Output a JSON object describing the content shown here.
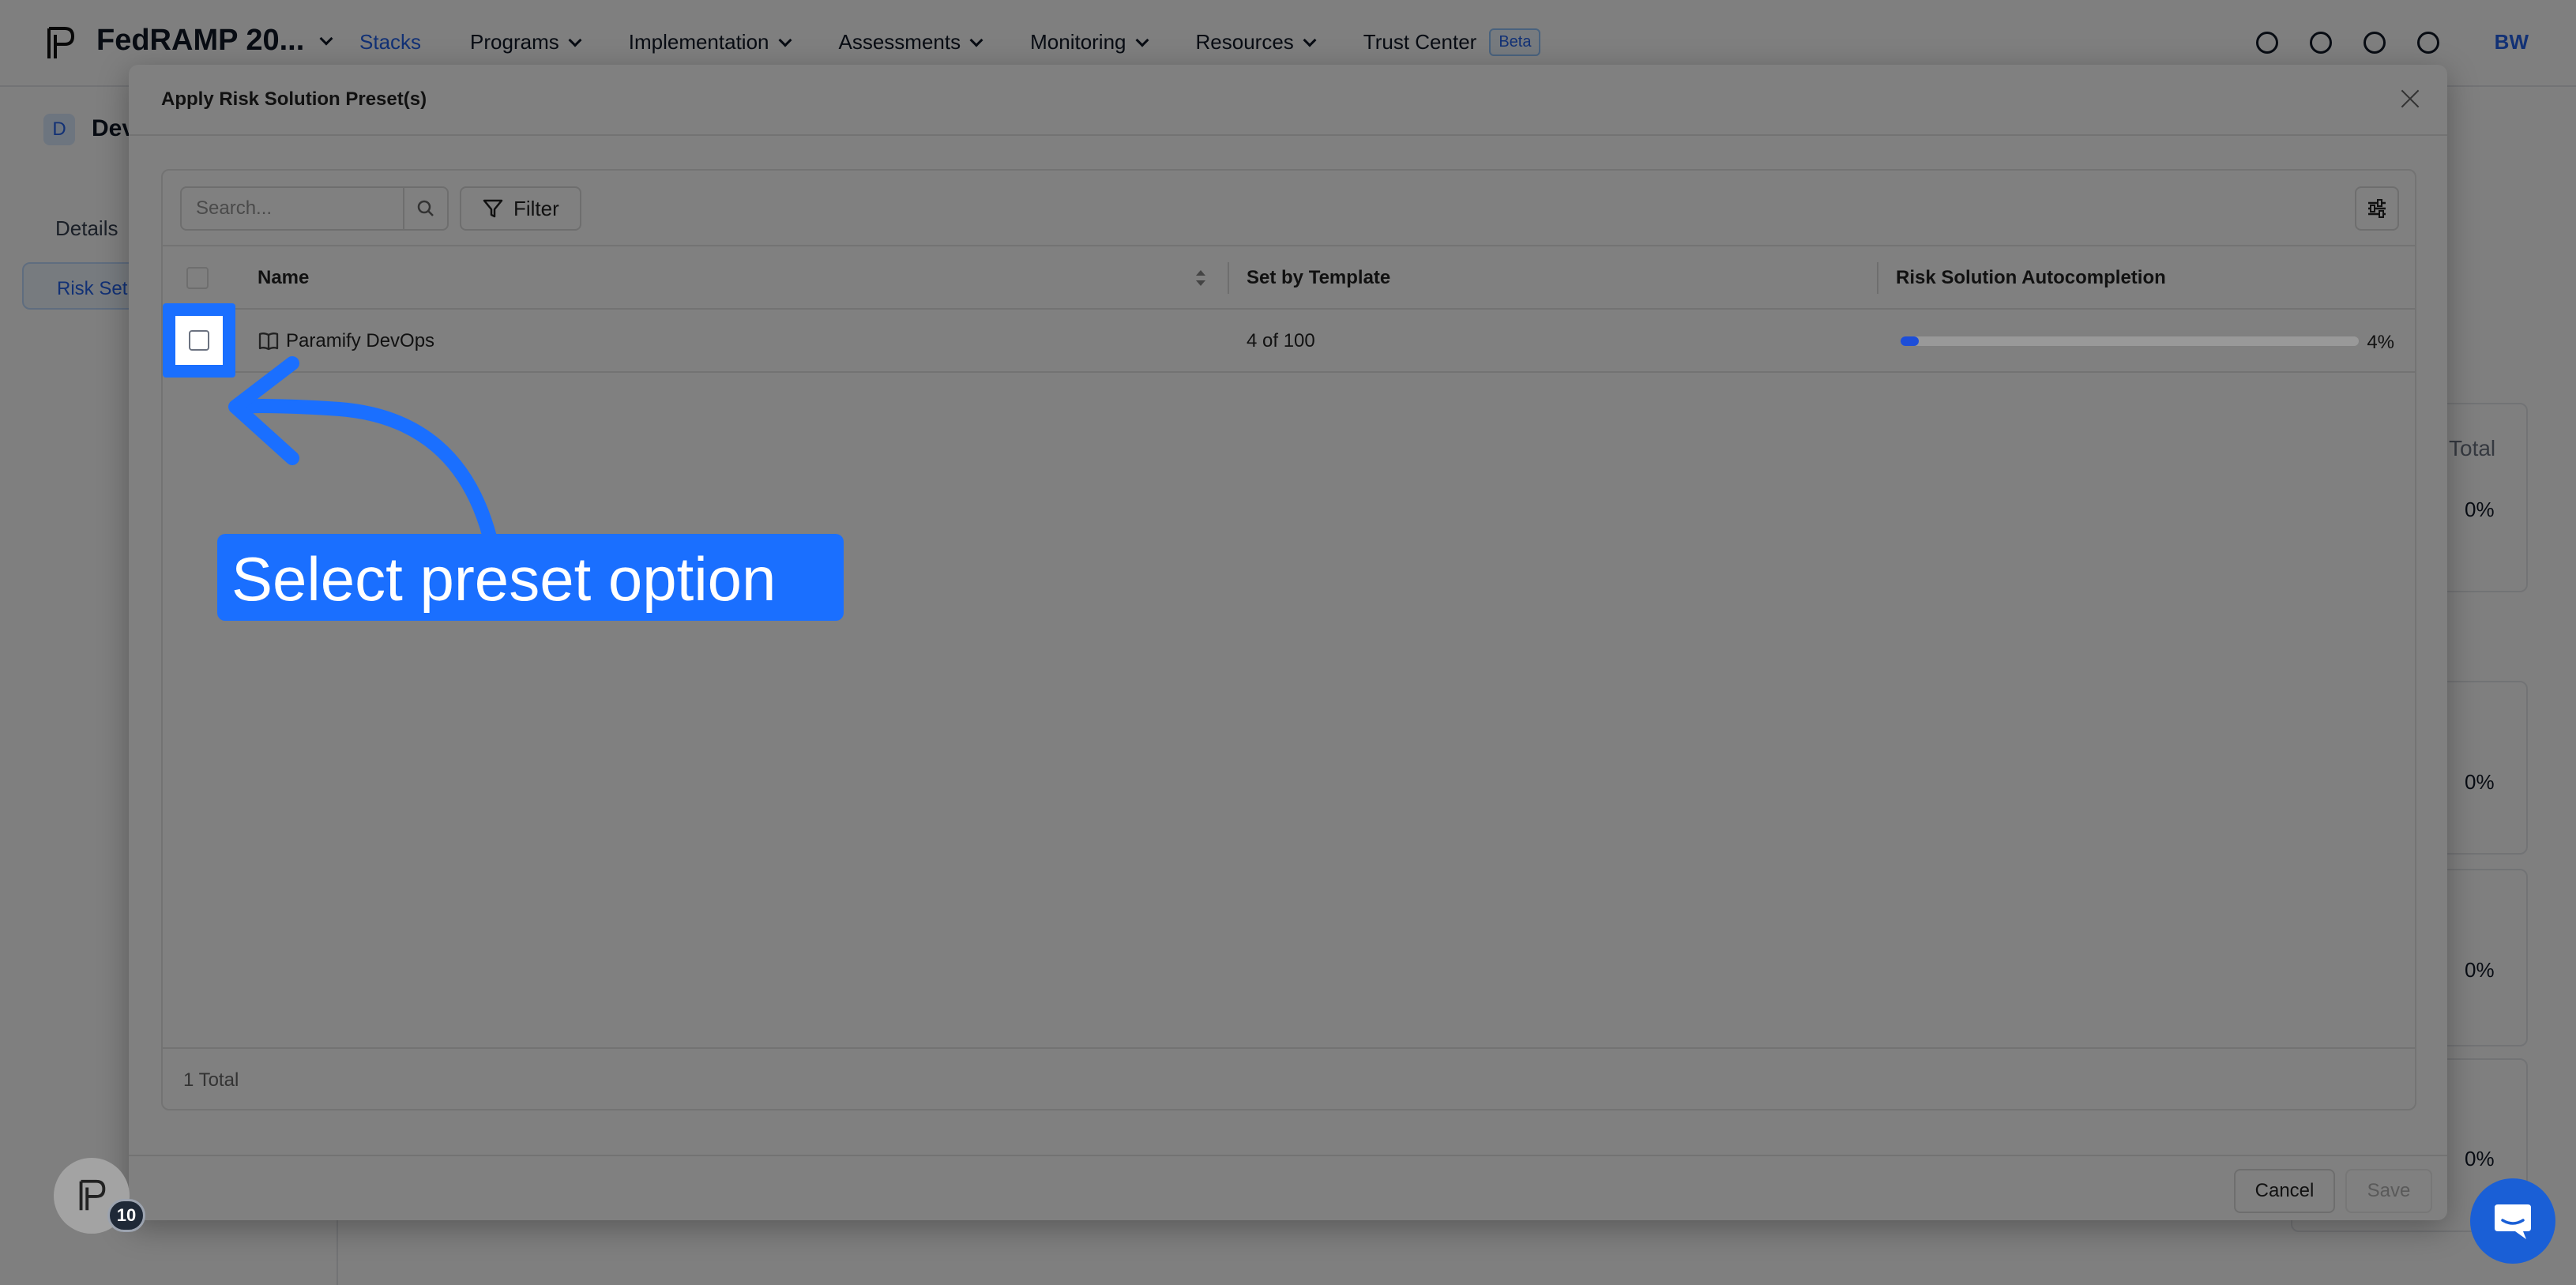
{
  "topnav": {
    "title": "FedRAMP 20...",
    "items": [
      {
        "label": "Stacks"
      },
      {
        "label": "Programs"
      },
      {
        "label": "Implementation"
      },
      {
        "label": "Assessments"
      },
      {
        "label": "Monitoring"
      },
      {
        "label": "Resources"
      },
      {
        "label": "Trust Center"
      }
    ],
    "beta_badge": "Beta",
    "user_initials": "BW",
    "icons": [
      "search-icon",
      "bell-icon",
      "help-icon",
      "gear-icon"
    ]
  },
  "sidebar": {
    "badge": "D",
    "name": "Dev",
    "items": [
      {
        "label": "Details"
      },
      {
        "label": "Risk Set"
      }
    ]
  },
  "background": {
    "total_label": "Total",
    "percentages": [
      "0%",
      "0%",
      "0%",
      "0%"
    ]
  },
  "modal": {
    "title": "Apply Risk Solution Preset(s)",
    "search": {
      "placeholder": "Search...",
      "value": ""
    },
    "filter_label": "Filter",
    "columns": [
      "Name",
      "Set by Template",
      "Risk Solution Autocompletion"
    ],
    "rows": [
      {
        "name": "Paramify DevOps",
        "set_by_template": "4 of 100",
        "autocompletion_pct": "4%",
        "autocompletion_value": 4,
        "selected": false
      }
    ],
    "total": "1 Total",
    "cancel_label": "Cancel",
    "save_label": "Save"
  },
  "callout": {
    "text": "Select preset option"
  },
  "floating": {
    "badge_count": "10"
  },
  "colors": {
    "accent": "#1a6fff",
    "brand_blue": "#2563eb",
    "progress": "#1d4ed8"
  }
}
